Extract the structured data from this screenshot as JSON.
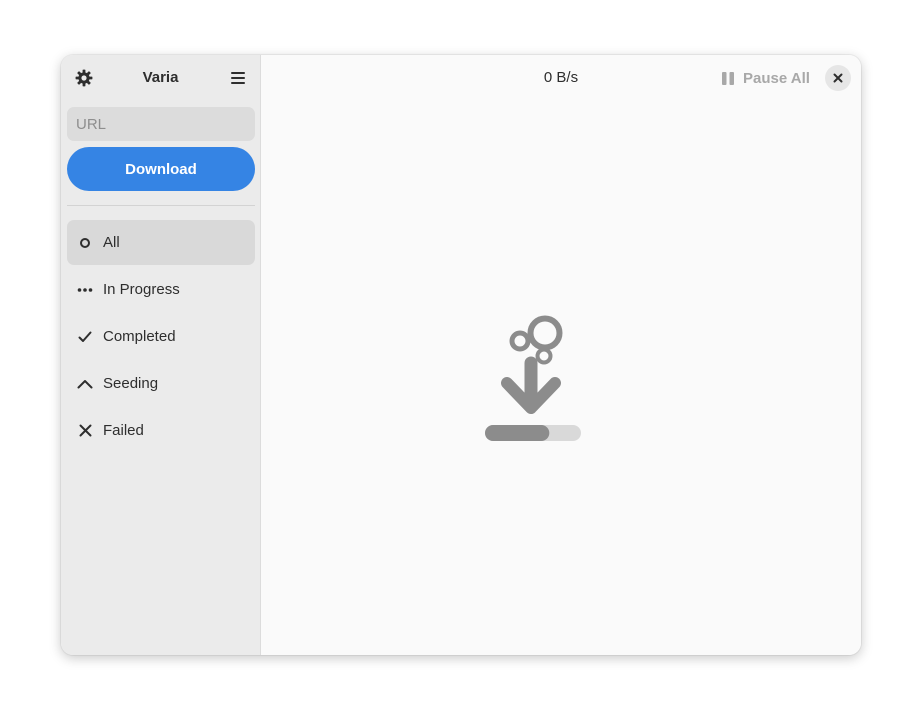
{
  "sidebar": {
    "title": "Varia",
    "settings_icon": "gear-icon",
    "menu_icon": "hamburger-menu-icon",
    "url_placeholder": "URL",
    "url_value": "",
    "download_label": "Download",
    "nav": [
      {
        "label": "All",
        "icon": "circle-outline-icon",
        "active": true
      },
      {
        "label": "In Progress",
        "icon": "ellipsis-icon",
        "active": false
      },
      {
        "label": "Completed",
        "icon": "checkmark-icon",
        "active": false
      },
      {
        "label": "Seeding",
        "icon": "chevron-up-icon",
        "active": false
      },
      {
        "label": "Failed",
        "icon": "x-icon",
        "active": false
      }
    ]
  },
  "header": {
    "speed": "0 B/s",
    "pause_all_label": "Pause All",
    "pause_icon": "pause-icon",
    "close_icon": "close-icon"
  },
  "empty_state": {
    "icon": "download-empty-state-icon",
    "progress_fraction": 0.67
  },
  "colors": {
    "accent": "#3584e4",
    "sidebar_bg": "#ebebeb",
    "content_bg": "#fafafa",
    "icon_gray": "#8c8c8c"
  }
}
